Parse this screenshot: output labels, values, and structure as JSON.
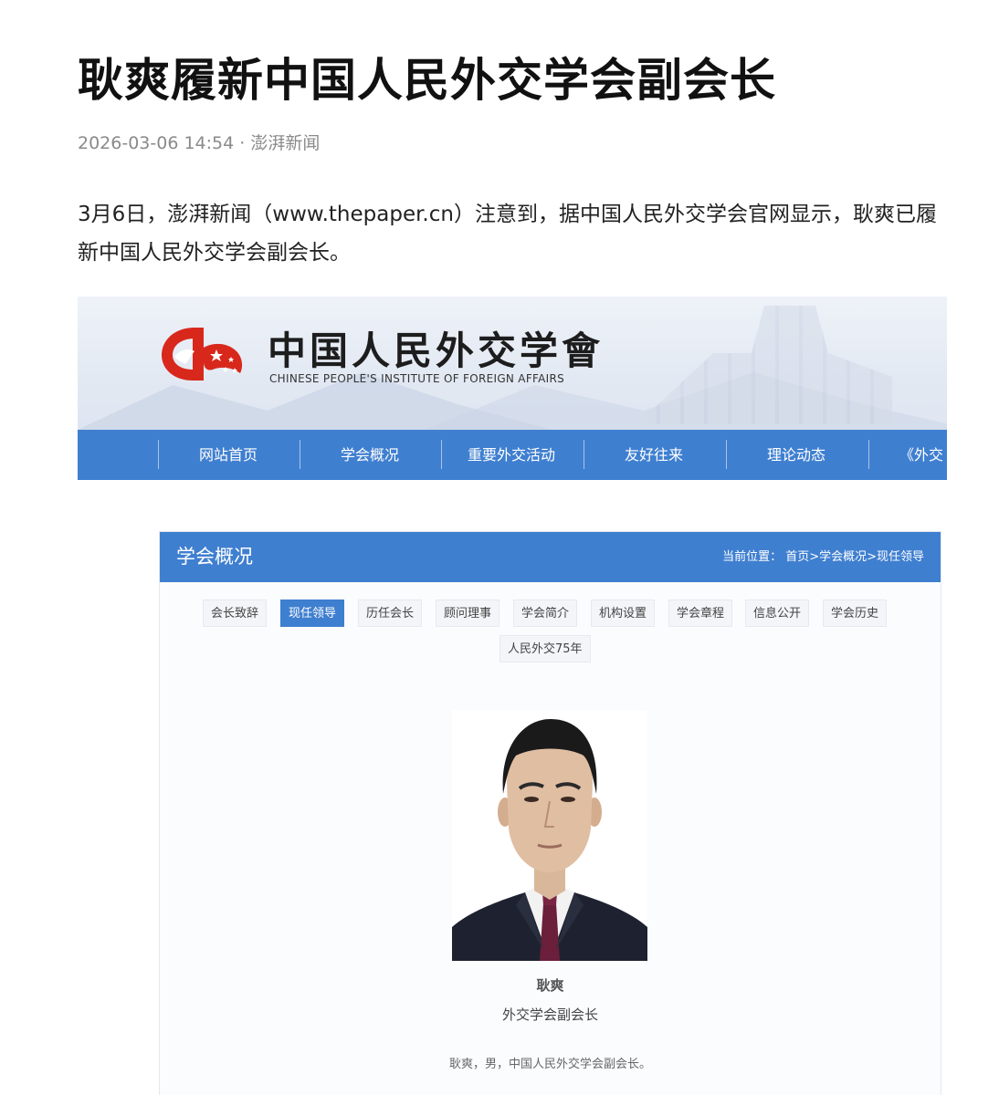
{
  "article": {
    "title": "耿爽履新中国人民外交学会副会长",
    "date": "2026-03-06 14:54",
    "separator": " · ",
    "source": "澎湃新闻",
    "lead": "3月6日，澎湃新闻（www.thepaper.cn）注意到，据中国人民外交学会官网显示，耿爽已履新中国人民外交学会副会长。"
  },
  "site": {
    "logo_cn": "中国人民外交学會",
    "logo_en": "CHINESE PEOPLE'S INSTITUTE OF FOREIGN AFFAIRS",
    "brand_red": "#d8281c",
    "nav_blue": "#3f7fd0",
    "nav": [
      "网站首页",
      "学会概况",
      "重要外交活动",
      "友好往来",
      "理论动态",
      "《外交"
    ],
    "panel_title": "学会概况",
    "breadcrumb": "当前位置： 首页>学会概况>现任领导",
    "subtabs": [
      "会长致辞",
      "现任领导",
      "历任会长",
      "顾问理事",
      "学会简介",
      "机构设置",
      "学会章程",
      "信息公开",
      "学会历史",
      "人民外交75年"
    ],
    "active_subtab": "现任领导",
    "person": {
      "name": "耿爽",
      "role": "外交学会副会长",
      "bio": "耿爽，男，中国人民外交学会副会长。"
    }
  }
}
